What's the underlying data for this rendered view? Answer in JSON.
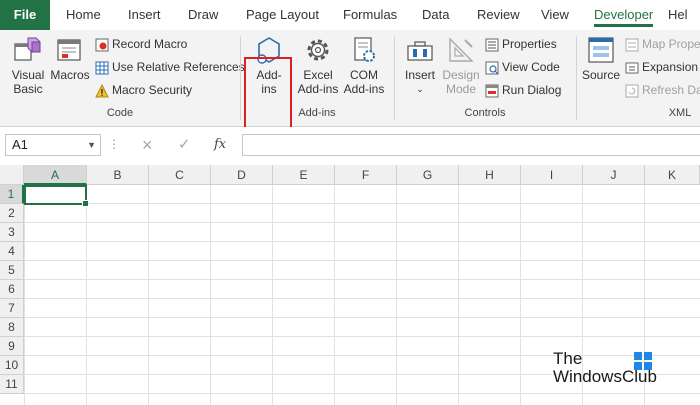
{
  "tabs": {
    "file": "File",
    "home": "Home",
    "insert": "Insert",
    "draw": "Draw",
    "page_layout": "Page Layout",
    "formulas": "Formulas",
    "data": "Data",
    "review": "Review",
    "view": "View",
    "developer": "Developer",
    "help": "Hel"
  },
  "ribbon": {
    "code": {
      "label": "Code",
      "visual_basic": [
        "Visual",
        "Basic"
      ],
      "macros": "Macros",
      "record_macro": "Record Macro",
      "relative_refs": "Use Relative References",
      "macro_security": "Macro Security"
    },
    "addins": {
      "label": "Add-ins",
      "addins_btn": [
        "Add-",
        "ins"
      ],
      "excel_addins": [
        "Excel",
        "Add-ins"
      ],
      "com_addins": [
        "COM",
        "Add-ins"
      ]
    },
    "controls": {
      "label": "Controls",
      "insert": "Insert",
      "design_mode": [
        "Design",
        "Mode"
      ],
      "properties": "Properties",
      "view_code": "View Code",
      "run_dialog": "Run Dialog"
    },
    "xml": {
      "label": "XML",
      "source": "Source",
      "map_properties": "Map Prope",
      "expansion": "Expansion P",
      "refresh_data": "Refresh Dat"
    }
  },
  "formula_bar": {
    "name_box": "A1",
    "cancel_icon": "×",
    "enter_icon": "✓",
    "fx": "fx",
    "value": ""
  },
  "grid": {
    "columns": [
      "A",
      "B",
      "C",
      "D",
      "E",
      "F",
      "G",
      "H",
      "I",
      "J",
      "K"
    ],
    "rows": [
      "1",
      "2",
      "3",
      "4",
      "5",
      "6",
      "7",
      "8",
      "9",
      "10",
      "11"
    ],
    "active_cell": "A1"
  },
  "watermark": {
    "line1": "The",
    "line2": "WindowsClub"
  },
  "colors": {
    "accent": "#217346",
    "highlight": "#e02020",
    "ribbon_bg": "#f3f3f3"
  }
}
